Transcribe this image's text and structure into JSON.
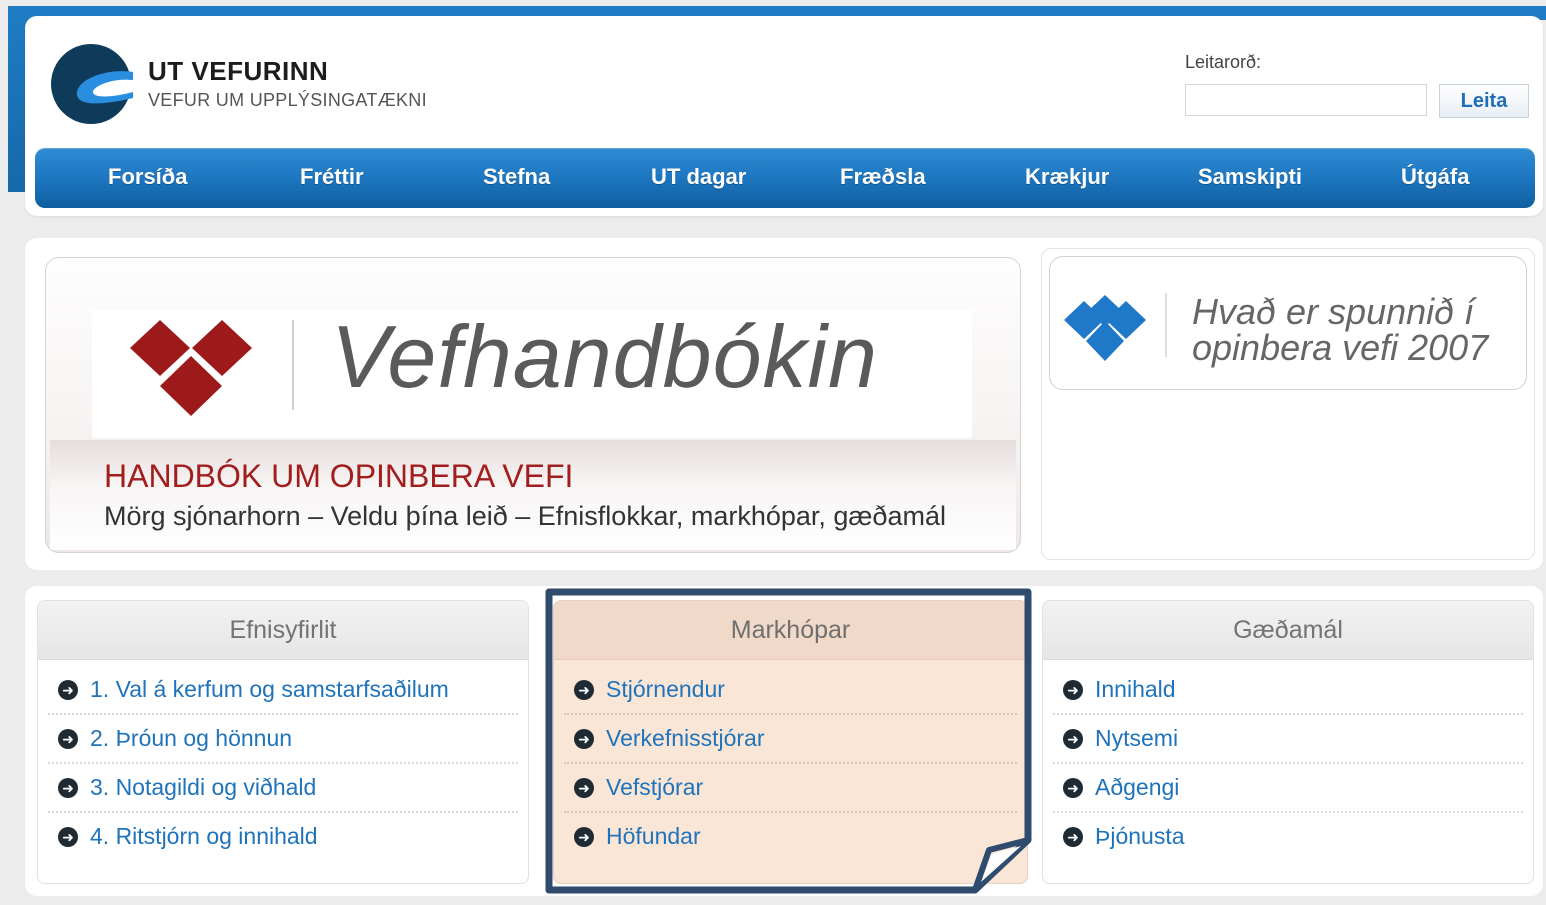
{
  "header": {
    "title": "UT VEFURINN",
    "subtitle": "VEFUR UM UPPLÝSINGATÆKNI",
    "search": {
      "label": "Leitarorð:",
      "value": "",
      "placeholder": "",
      "button": "Leita"
    }
  },
  "nav": {
    "items": [
      "Forsíða",
      "Fréttir",
      "Stefna",
      "UT dagar",
      "Fræðsla",
      "Krækjur",
      "Samskipti",
      "Útgáfa"
    ]
  },
  "banner": {
    "title": "Vefhandbókin",
    "heading": "HANDBÓK UM OPINBERA VEFI",
    "subheading": "Mörg sjónarhorn – Veldu þína leið – Efnisflokkar, markhópar, gæðamál"
  },
  "side_banner": {
    "line1": "Hvað er spunnið í",
    "line2": "opinbera vefi 2007"
  },
  "columns": [
    {
      "title": "Efnisyfirlit",
      "links": [
        "1. Val á kerfum og samstarfsaðilum",
        "2. Þróun og hönnun",
        "3. Notagildi og viðhald",
        "4. Ritstjórn og innihald"
      ]
    },
    {
      "title": "Markhópar",
      "links": [
        "Stjórnendur",
        "Verkefnisstjórar",
        "Vefstjórar",
        "Höfundar"
      ]
    },
    {
      "title": "Gæðamál",
      "links": [
        "Innihald",
        "Nytsemi",
        "Aðgengi",
        "Þjónusta"
      ]
    }
  ],
  "icons": {
    "list_bullet": "arrow-circle-right-icon",
    "logo": "ut-vefurinn-logo-icon"
  },
  "colors": {
    "nav_blue": "#1d76c0",
    "link_blue": "#1f73bb",
    "banner_red": "#a21e1e",
    "diamond_blue": "#1f78c8",
    "highlight_fill": "#f9e6d7",
    "highlight_border": "#2f4b6e"
  }
}
